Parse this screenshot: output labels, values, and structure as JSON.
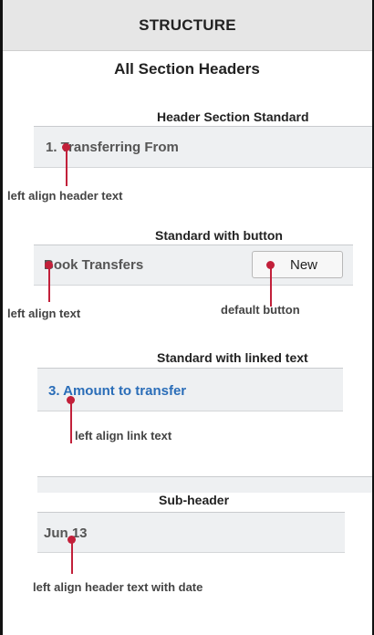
{
  "header": {
    "title": "STRUCTURE"
  },
  "page": {
    "title": "All Section Headers"
  },
  "sections": [
    {
      "label": "Header Section Standard",
      "row_text": "1. Transferring From",
      "annotation": "left align header text"
    },
    {
      "label": "Standard with button",
      "row_text": "Book Transfers",
      "button_label": "New",
      "annotation_text": "left align text",
      "annotation_button": "default button"
    },
    {
      "label": "Standard with linked text",
      "row_text": "3. Amount to transfer",
      "annotation": "left align link text"
    },
    {
      "label": "Sub-header",
      "row_text": "Jun 13",
      "annotation": "left align header text with date"
    }
  ],
  "colors": {
    "topbar_bg": "#e6e6e6",
    "row_bg": "#eef0f2",
    "link": "#2a6db8",
    "annotation_pin": "#c2203a"
  }
}
